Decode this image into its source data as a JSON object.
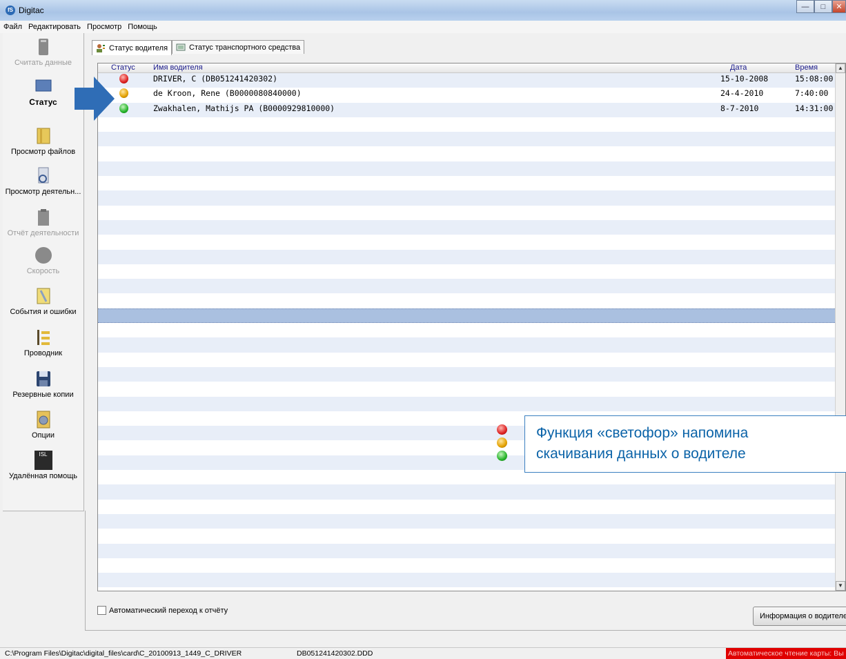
{
  "window": {
    "title": "Digitac",
    "app_icon": "fS"
  },
  "menu": [
    "Файл",
    "Редактировать",
    "Просмотр",
    "Помощь"
  ],
  "sidebar": {
    "items": [
      {
        "label": "Считать данные",
        "icon": "card-reader-icon",
        "disabled": true
      },
      {
        "label": "Статус",
        "icon": "monitor-icon",
        "active": true
      },
      {
        "label": "Просмотр файлов",
        "icon": "folder-icon"
      },
      {
        "label": "Просмотр деятельн...",
        "icon": "search-document-icon"
      },
      {
        "label": "Отчёт деятельности",
        "icon": "clipboard-icon",
        "disabled": true
      },
      {
        "label": "Скорость",
        "icon": "speedometer-icon",
        "disabled": true
      },
      {
        "label": "События и ошибки",
        "icon": "tools-icon"
      },
      {
        "label": "Проводник",
        "icon": "explorer-tree-icon"
      },
      {
        "label": "Резервные копии",
        "icon": "floppy-disk-icon"
      },
      {
        "label": "Опции",
        "icon": "settings-gear-icon"
      },
      {
        "label": "Удалённая помощь",
        "icon": "isl-remote-icon",
        "icon_text": "ISL"
      }
    ]
  },
  "tabs": [
    {
      "label": "Статус водителя",
      "active": true
    },
    {
      "label": "Статус транспортного средства",
      "active": false
    }
  ],
  "table": {
    "headers": {
      "status": "Статус",
      "name": "Имя водителя",
      "date": "Дата",
      "time": "Время"
    },
    "rows": [
      {
        "status": "red",
        "name": "DRIVER, C (DB051241420302)",
        "date": "15-10-2008",
        "time": "15:08:00"
      },
      {
        "status": "amber",
        "name": "de Kroon, Rene (B0000080840000)",
        "date": "24-4-2010",
        "time": "7:40:00"
      },
      {
        "status": "green",
        "name": "Zwakhalen, Mathijs PA (B0000929810000)",
        "date": "8-7-2010",
        "time": "14:31:00"
      }
    ],
    "selected_row_index": 16
  },
  "auto_jump": {
    "label": "Автоматический переход к отчёту",
    "checked": false
  },
  "driver_info_button": "Информация о водителе",
  "statusbar": {
    "path": "C:\\Program Files\\Digitac\\digital_files\\card\\C_20100913_1449_C_DRIVER",
    "file": "DB051241420302.DDD",
    "auto_read": "Автоматическое чтение карты: Вы"
  },
  "callout": {
    "line1": "Функция «светофор» напомина",
    "line2": "скачивания данных о водителе"
  },
  "colors": {
    "accent": "#0b63a8",
    "arrow": "#2f6db6",
    "status_alert": "#e00000"
  }
}
